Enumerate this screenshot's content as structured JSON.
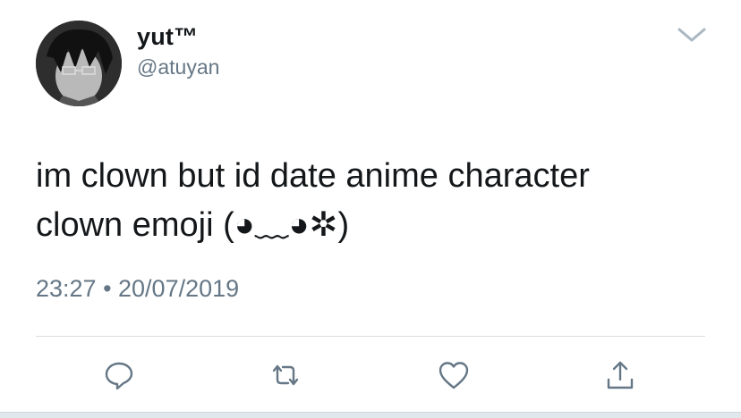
{
  "user": {
    "display_name": "yut™",
    "handle": "@atuyan",
    "avatar_icon": "anime-character-avatar"
  },
  "tweet": {
    "lines": [
      "im clown but id date anime character",
      "clown emoji (◕﹏◕✲)"
    ],
    "timestamp": "23:27 • 20/07/2019"
  },
  "actions": {
    "reply_icon": "reply-icon",
    "retweet_icon": "retweet-icon",
    "like_icon": "like-icon",
    "share_icon": "share-icon"
  },
  "menu_icon": "chevron-down-icon",
  "colors": {
    "text": "#14171a",
    "secondary": "#657786",
    "icon": "#657786",
    "divider": "#d9dee2"
  }
}
